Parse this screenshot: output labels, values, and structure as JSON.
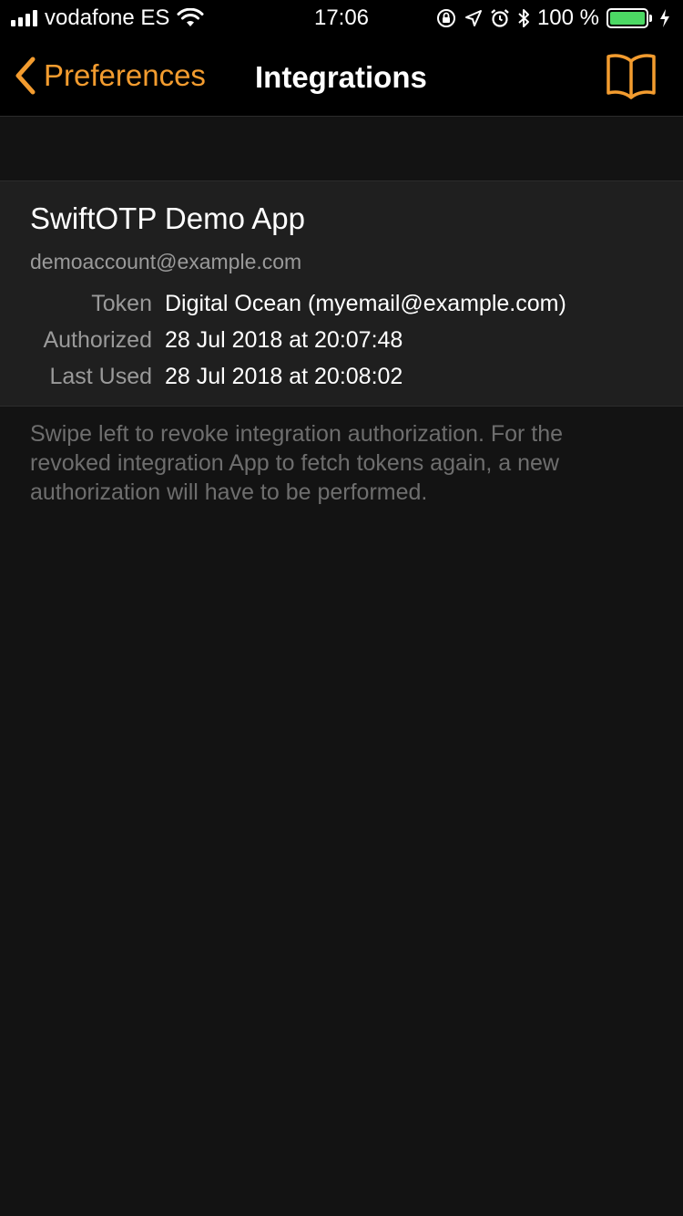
{
  "status_bar": {
    "carrier": "vodafone ES",
    "time": "17:06",
    "battery_percent": "100 %",
    "battery_level": 1.0,
    "icons": [
      "signal-icon",
      "wifi-icon",
      "orientation-lock-icon",
      "location-icon",
      "alarm-icon",
      "bluetooth-icon",
      "battery-icon",
      "charging-icon"
    ]
  },
  "nav": {
    "back_label": "Preferences",
    "title": "Integrations",
    "right_icon": "book-icon"
  },
  "integration": {
    "app_name": "SwiftOTP Demo App",
    "account": "demoaccount@example.com",
    "rows": [
      {
        "label": "Token",
        "value": "Digital Ocean (myemail@example.com)"
      },
      {
        "label": "Authorized",
        "value": "28 Jul 2018 at 20:07:48"
      },
      {
        "label": "Last Used",
        "value": "28 Jul 2018 at 20:08:02"
      }
    ]
  },
  "footer_text": "Swipe left to revoke integration authorization. For the revoked integration App to fetch tokens again, a new authorization will have to be performed.",
  "colors": {
    "accent": "#f39c2f",
    "background": "#131313",
    "cell_background": "#1f1f1f",
    "secondary_text": "#9a9a9a",
    "footer_text": "#6e6e6e",
    "battery_fill": "#4cd964"
  }
}
